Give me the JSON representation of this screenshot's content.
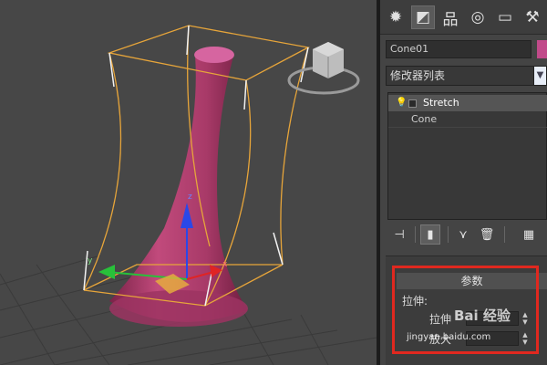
{
  "viewport": {
    "gizmo_axes": {
      "x": "x",
      "y": "y",
      "z": "z"
    }
  },
  "panel": {
    "tabs": [
      {
        "icon": "create-icon",
        "glyph": "✹"
      },
      {
        "icon": "modify-icon",
        "glyph": "◩"
      },
      {
        "icon": "hierarchy-icon",
        "glyph": "品"
      },
      {
        "icon": "motion-icon",
        "glyph": "◎"
      },
      {
        "icon": "display-icon",
        "glyph": "▭"
      },
      {
        "icon": "utilities-icon",
        "glyph": "⚒"
      }
    ],
    "object_name": "Cone01",
    "object_color": "#c14a8a",
    "modifier_list": "修改器列表",
    "stack": {
      "modifier": "Stretch",
      "base": "Cone"
    },
    "rollout_title": "参数",
    "group_label": "拉伸:",
    "params": [
      {
        "label": "拉伸",
        "value": ""
      },
      {
        "label": "放大",
        "value": ""
      }
    ]
  },
  "watermark": {
    "logo": "Bai 经验",
    "url": "jingyan.baidu.com"
  },
  "colors": {
    "highlight": "#e0281f",
    "cone": "#b8406f",
    "bbox": "#e7a53a"
  }
}
